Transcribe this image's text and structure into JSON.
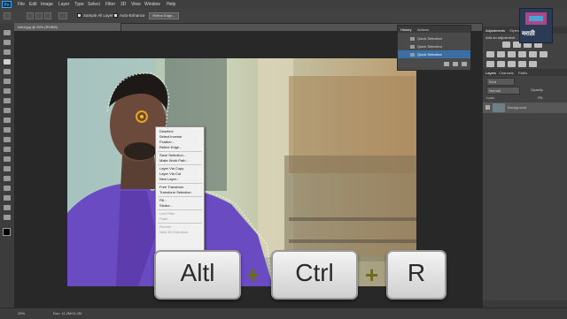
{
  "app": {
    "logo_text": "Ps"
  },
  "menu": [
    "File",
    "Edit",
    "Image",
    "Layer",
    "Type",
    "Select",
    "Filter",
    "3D",
    "View",
    "Window",
    "Help"
  ],
  "options_bar": {
    "sample_all_layers": "Sample All Layers",
    "auto_enhance": "Auto-Enhance",
    "refine_edge": "Refine Edge..."
  },
  "document": {
    "tab_title": "mitul.jpg @ 25% (RGB/8)"
  },
  "history_panel": {
    "tabs": [
      "History",
      "Actions"
    ],
    "items": [
      "Quick Selection",
      "Quick Selection",
      "Quick Selection"
    ]
  },
  "adjustments_panel": {
    "tabs": [
      "Adjustments",
      "Styles"
    ],
    "subtitle": "Add an adjustment"
  },
  "layers_panel": {
    "tabs": [
      "Layers",
      "Channels",
      "Paths"
    ],
    "kind": "Kind",
    "blend_mode": "Normal",
    "opacity_label": "Opacity:",
    "lock_label": "Lock:",
    "fill_label": "Fill:",
    "layer_name": "Background"
  },
  "context_menu": {
    "items": [
      {
        "label": "Deselect",
        "enabled": true
      },
      {
        "label": "Select Inverse",
        "enabled": true
      },
      {
        "label": "Feather...",
        "enabled": true
      },
      {
        "label": "Refine Edge...",
        "enabled": true
      },
      {
        "sep": true
      },
      {
        "label": "Save Selection...",
        "enabled": true
      },
      {
        "label": "Make Work Path...",
        "enabled": true
      },
      {
        "sep": true
      },
      {
        "label": "Layer Via Copy",
        "enabled": true
      },
      {
        "label": "Layer Via Cut",
        "enabled": true
      },
      {
        "label": "New Layer...",
        "enabled": true
      },
      {
        "sep": true
      },
      {
        "label": "Free Transform",
        "enabled": true
      },
      {
        "label": "Transform Selection",
        "enabled": true
      },
      {
        "sep": true
      },
      {
        "label": "Fill...",
        "enabled": true
      },
      {
        "label": "Stroke...",
        "enabled": true
      },
      {
        "sep": true
      },
      {
        "label": "Last Filter",
        "enabled": false
      },
      {
        "label": "Fade...",
        "enabled": false
      },
      {
        "sep": true
      },
      {
        "label": "Render",
        "enabled": false
      },
      {
        "label": "New 3D Extrusion",
        "enabled": false
      }
    ]
  },
  "keys": {
    "key1": "Altl",
    "key2": "Ctrl",
    "key3": "R",
    "plus": "+"
  },
  "badge": {
    "text": "मराठी"
  },
  "status": {
    "zoom": "25%",
    "doc": "Doc: 11.2M/11.2M"
  },
  "colors": {
    "accent": "#3fa9f5",
    "menu_bg": "#3f3f3f",
    "panel_bg": "#424242",
    "selection_highlight": "#3a6ea5"
  }
}
